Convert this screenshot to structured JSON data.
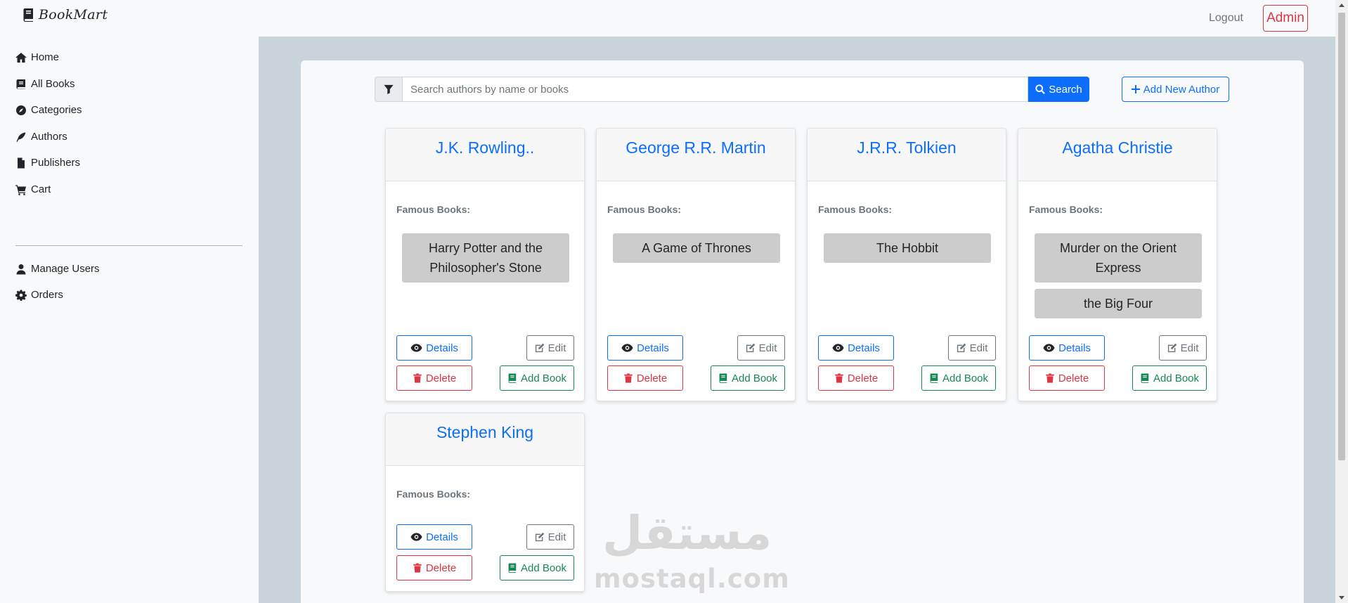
{
  "brand": {
    "name": "BookMart",
    "icon": "book-icon"
  },
  "topbar": {
    "logout": "Logout",
    "admin": "Admin"
  },
  "sidebar": {
    "items": [
      {
        "label": "Home",
        "icon": "home-icon"
      },
      {
        "label": "All Books",
        "icon": "book-icon"
      },
      {
        "label": "Categories",
        "icon": "compass-icon"
      },
      {
        "label": "Authors",
        "icon": "feather-icon"
      },
      {
        "label": "Publishers",
        "icon": "file-icon"
      },
      {
        "label": "Cart",
        "icon": "cart-icon"
      }
    ],
    "admin_items": [
      {
        "label": "Manage Users",
        "icon": "user-icon"
      },
      {
        "label": "Orders",
        "icon": "gear-icon"
      }
    ]
  },
  "search": {
    "placeholder": "Search authors by name or books",
    "value": "",
    "button": "Search",
    "filter_icon": "filter-icon"
  },
  "add_author": {
    "label": "Add New Author"
  },
  "labels": {
    "famous_books": "Famous Books:",
    "details": "Details",
    "edit": "Edit",
    "delete": "Delete",
    "add_book": "Add Book"
  },
  "authors": [
    {
      "name": "J.K. Rowling..",
      "books": [
        "Harry Potter and the Philosopher's Stone"
      ]
    },
    {
      "name": "George R.R. Martin",
      "books": [
        "A Game of Thrones"
      ]
    },
    {
      "name": "J.R.R. Tolkien",
      "books": [
        "The Hobbit"
      ]
    },
    {
      "name": "Agatha Christie",
      "books": [
        "Murder on the Orient Express",
        "the Big Four"
      ]
    },
    {
      "name": "Stephen King",
      "books": []
    }
  ],
  "watermark": {
    "latin": "mostaql.com",
    "arabic": "مستقل"
  },
  "colors": {
    "primary": "#0d6efd",
    "danger": "#dc3545",
    "success": "#198754",
    "secondary": "#6c757d",
    "main_bg": "#c8d3da"
  }
}
